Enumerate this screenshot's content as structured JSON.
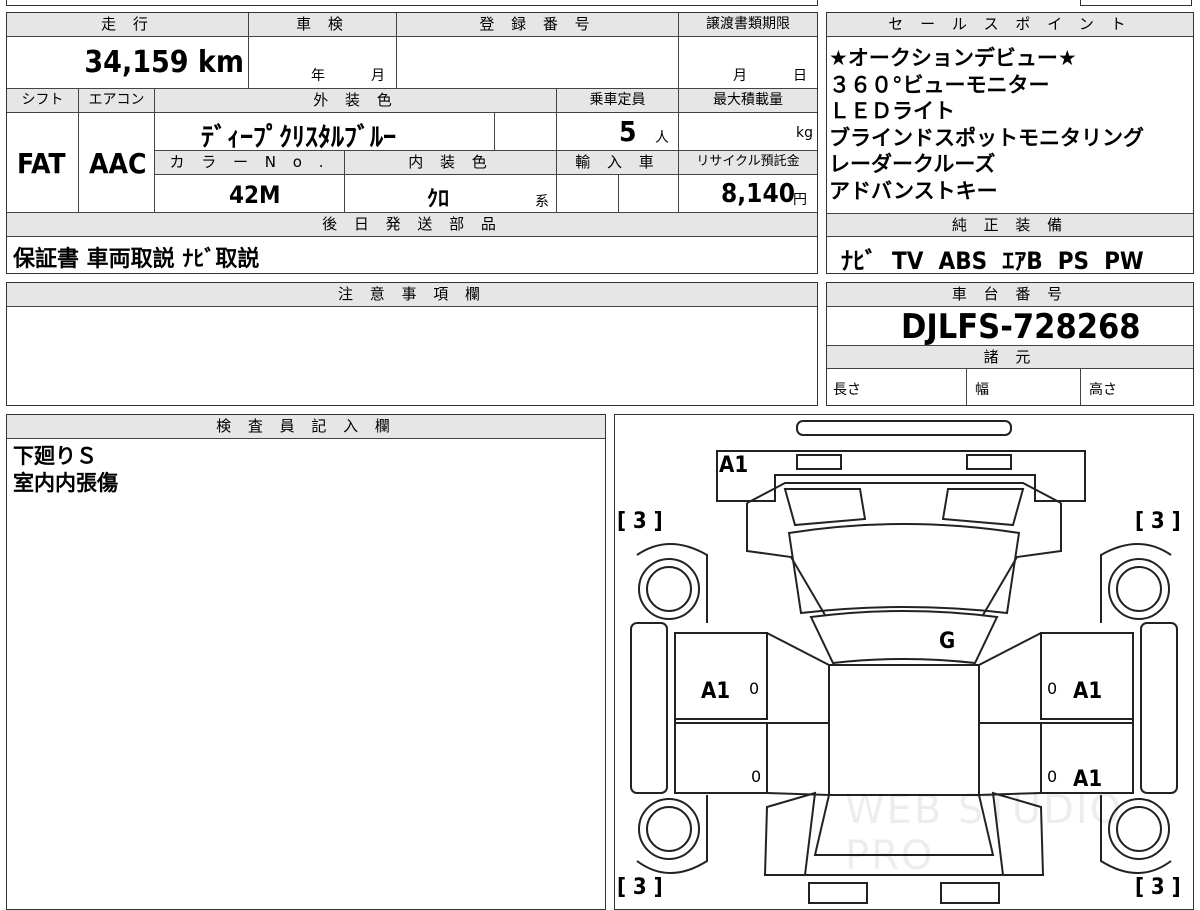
{
  "top": {
    "mileage_label": "走 行",
    "mileage_value": "34,159 km",
    "inspection_label": "車 検",
    "inspection_year": "年",
    "inspection_month": "月",
    "registration_label": "登 録 番 号",
    "transfer_label": "譲渡書類期限",
    "transfer_month": "月",
    "transfer_day": "日",
    "shift_label": "シフト",
    "shift_value": "FAT",
    "ac_label": "エアコン",
    "ac_value": "AAC",
    "exterior_label": "外 装 色",
    "exterior_value": "ﾃﾞｨｰﾌﾟｸﾘｽﾀﾙﾌﾞﾙｰ",
    "capacity_label": "乗車定員",
    "capacity_value": "5",
    "capacity_unit": "人",
    "maxload_label": "最大積載量",
    "maxload_unit": "kg",
    "colorno_label": "カ ラ ー N o .",
    "colorno_value": "42M",
    "interior_label": "内 装 色",
    "interior_value": "ｸﾛ",
    "interior_suffix": "系",
    "import_label": "輸 入 車",
    "recycle_label": "リサイクル預託金",
    "recycle_value": "8,140",
    "recycle_unit": "円",
    "later_label": "後 日 発 送 部 品",
    "later_value": "保証書 車両取説 ﾅﾋﾞ取説"
  },
  "sales": {
    "label": "セ ー ル ス ポ イ ン ト",
    "points": [
      "★オークションデビュー★",
      "３６０°ビューモニター",
      "ＬＥＤライト",
      "ブラインドスポットモニタリング",
      "レーダークルーズ",
      "アドバンストキー"
    ],
    "equipment_label": "純 正 装 備",
    "equipment_value": "ﾅﾋﾞ  TV  ABS  ｴｱB  PS  PW"
  },
  "notes": {
    "label": "注 意 事 項 欄"
  },
  "chassis": {
    "label": "車 台 番 号",
    "value": "DJLFS-728268",
    "spec_label": "諸 元",
    "length": "長さ",
    "width": "幅",
    "height": "高さ"
  },
  "inspector": {
    "label": "検 査 員 記 入 欄",
    "lines": [
      "下廻りＳ",
      "室内内張傷"
    ]
  },
  "diagram": {
    "marks": {
      "front_bumper": "A1",
      "windshield": "G",
      "left_front_door": "A1",
      "right_front_door": "A1",
      "right_rear_door": "A1",
      "zero_lf": "0",
      "zero_lr": "0",
      "zero_rf": "0",
      "zero_rr": "0"
    },
    "tires": {
      "front_left": "[ 3 ]",
      "front_right": "[ 3 ]",
      "rear_left": "[ 3 ]",
      "rear_right": "[ 3 ]"
    },
    "watermark": "WEB STUDIO PRO"
  }
}
